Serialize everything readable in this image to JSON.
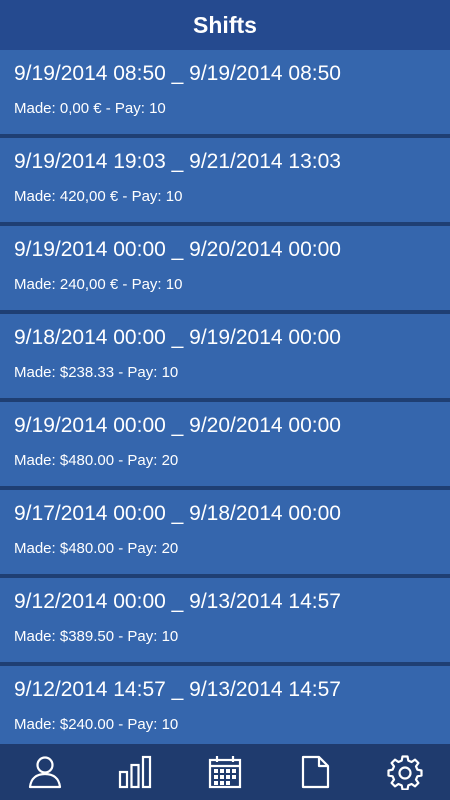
{
  "header": {
    "title": "Shifts"
  },
  "shifts": [
    {
      "dates": "9/19/2014 08:50 _ 9/19/2014 08:50",
      "made": "Made: 0,00 € - Pay: 10"
    },
    {
      "dates": "9/19/2014 19:03 _ 9/21/2014 13:03",
      "made": "Made: 420,00 € - Pay: 10"
    },
    {
      "dates": "9/19/2014 00:00 _ 9/20/2014 00:00",
      "made": "Made: 240,00 € - Pay: 10"
    },
    {
      "dates": "9/18/2014 00:00 _ 9/19/2014 00:00",
      "made": "Made: $238.33 - Pay: 10"
    },
    {
      "dates": "9/19/2014 00:00 _ 9/20/2014 00:00",
      "made": "Made: $480.00 - Pay: 20"
    },
    {
      "dates": "9/17/2014 00:00 _ 9/18/2014 00:00",
      "made": "Made: $480.00 - Pay: 20"
    },
    {
      "dates": "9/12/2014 00:00 _ 9/13/2014 14:57",
      "made": "Made: $389.50 - Pay: 10"
    },
    {
      "dates": "9/12/2014 14:57 _ 9/13/2014 14:57",
      "made": "Made: $240.00 - Pay: 10"
    }
  ],
  "bottom_nav": [
    {
      "icon": "user-icon"
    },
    {
      "icon": "bar-chart-icon"
    },
    {
      "icon": "calendar-icon"
    },
    {
      "icon": "document-icon"
    },
    {
      "icon": "settings-gear-icon"
    }
  ],
  "colors": {
    "header_bg": "#254a8f",
    "row_bg": "#3566ad",
    "row_separator": "#1f3f73",
    "bottom_bar_bg": "#1f3b6e",
    "text": "#ffffff"
  }
}
